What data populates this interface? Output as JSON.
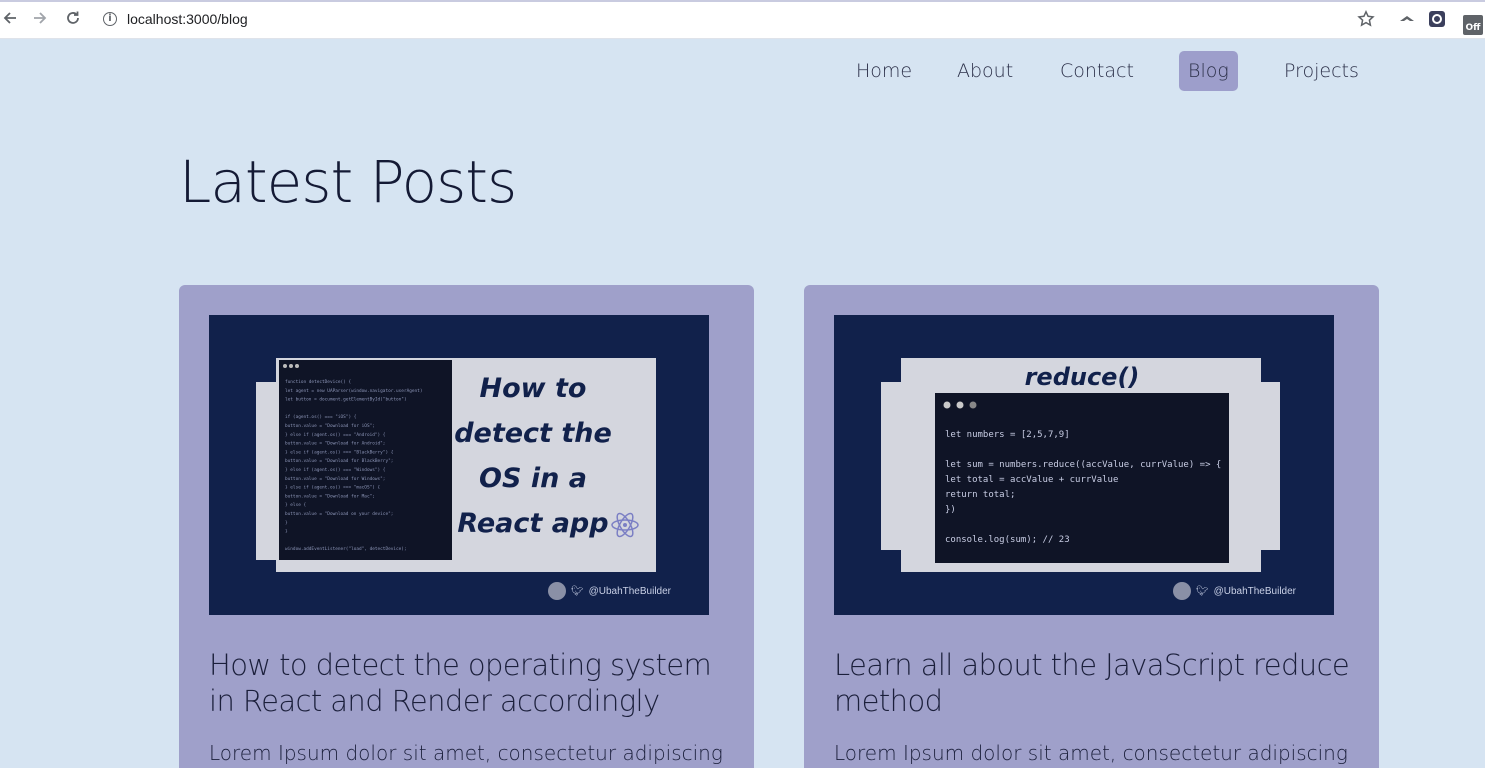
{
  "browser": {
    "url": "localhost:3000/blog",
    "icons": [
      "back-arrow-icon",
      "forward-arrow-icon",
      "reload-icon",
      "info-icon",
      "star-icon",
      "extension-icon",
      "extension-icon",
      "extension-off-icon"
    ],
    "ext_off_label": "Off"
  },
  "nav": {
    "items": [
      {
        "label": "Home"
      },
      {
        "label": "About"
      },
      {
        "label": "Contact"
      },
      {
        "label": "Blog",
        "active": true
      },
      {
        "label": "Projects"
      }
    ],
    "active_color": "#9d9ecb"
  },
  "page": {
    "heading": "Latest Posts",
    "background": "#d6e4f2",
    "card_color": "#9fa0ca"
  },
  "posts": [
    {
      "title": "How to detect the operating system in React and Render accordingly",
      "excerpt": "Lorem Ipsum dolor sit amet, consectetur adipiscing elit, sed",
      "thumb": {
        "headline": [
          "How to",
          "detect the",
          "OS in a",
          "React app"
        ],
        "credit": "@UbahTheBuilder",
        "icon": "react-atom-icon",
        "code": [
          "function detectDevice() {",
          "  let agent = new UAParser(window.navigator.userAgent)",
          "  let button = document.getElementById(\"button\")",
          "",
          "  if (agent.os() === \"iOS\") {",
          "    button.value = \"Download for iOS\";",
          "  } else if (agent.os() === \"Android\") {",
          "    button.value = \"Download for Android\";",
          "  } else if (agent.os() === \"BlackBerry\") {",
          "    button.value = \"Download for BlackBerry\";",
          "  } else if (agent.os() === \"Windows\") {",
          "    button.value = \"Download for Windows\";",
          "  } else if (agent.os() === \"macOS\") {",
          "    button.value = \"Download for Mac\";",
          "  } else {",
          "    button.value = \"Download on your device\";",
          "  }",
          "}",
          "",
          "window.addEventListener(\"load\", detectDevice);"
        ]
      }
    },
    {
      "title": "Learn all about the JavaScript reduce method",
      "excerpt": "Lorem Ipsum dolor sit amet, consectetur adipiscing elit, sed",
      "thumb": {
        "headline": [
          "reduce()"
        ],
        "credit": "@UbahTheBuilder",
        "code": [
          "let numbers = [2,5,7,9]",
          "",
          "let sum = numbers.reduce((accValue, currValue) => {",
          "let total = accValue + currValue",
          "  return total;",
          "})",
          "",
          "console.log(sum); // 23"
        ]
      }
    }
  ]
}
